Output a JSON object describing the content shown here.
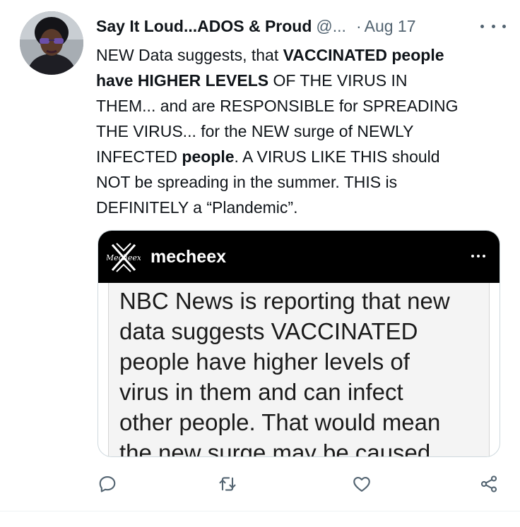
{
  "tweet": {
    "display_name": "Say It Loud...ADOS & Proud",
    "handle": "@...",
    "separator": "·",
    "date": "Aug 17",
    "text_lines": [
      [
        {
          "t": "NEW Data suggests, that ",
          "b": false
        },
        {
          "t": "VACCINATED people",
          "b": true
        }
      ],
      [
        {
          "t": "have HIGHER LEVELS",
          "b": true
        },
        {
          "t": " OF THE VIRUS IN",
          "b": false
        }
      ],
      [
        {
          "t": "THEM... and are RESPONSIBLE for SPREADING",
          "b": false
        }
      ],
      [
        {
          "t": "THE VIRUS... for the NEW surge of NEWLY",
          "b": false
        }
      ],
      [
        {
          "t": "INFECTED ",
          "b": false
        },
        {
          "t": "people",
          "b": true
        },
        {
          "t": ".  A VIRUS LIKE THIS should",
          "b": false
        }
      ],
      [
        {
          "t": "NOT be spreading in the summer. THIS is",
          "b": false
        }
      ],
      [
        {
          "t": "DEFINITELY a “Plandemic”.",
          "b": false
        }
      ]
    ]
  },
  "media": {
    "username": "mecheex",
    "logo_text": "Mecheex",
    "text_lines": [
      "NBC News is reporting that new",
      "data suggests VACCINATED",
      "people have higher levels of",
      "virus in them and can infect",
      "other people. That would mean",
      "the new surge may be caused"
    ]
  },
  "icons": {
    "avatar": "profile-photo",
    "more": "more-horizontal-icon",
    "reply": "reply-icon",
    "retweet": "retweet-icon",
    "like": "heart-icon",
    "share": "share-icon"
  },
  "colors": {
    "text": "#0f1419",
    "secondary": "#536471",
    "border": "#cfd9de",
    "media_bar": "#000000"
  }
}
